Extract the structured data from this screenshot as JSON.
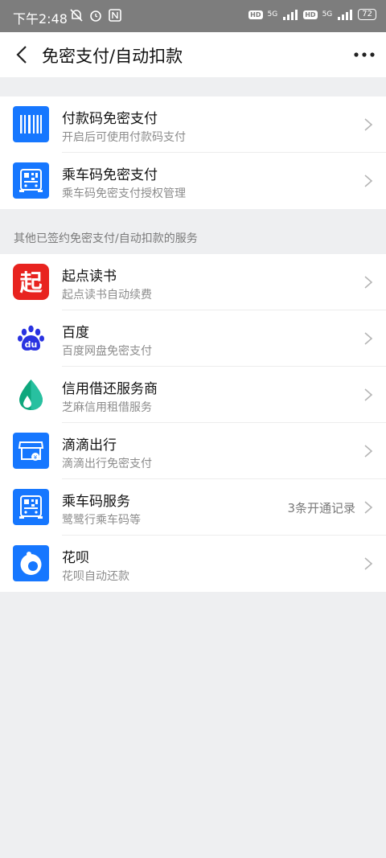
{
  "status": {
    "time": "下午2:48",
    "network1": "5G",
    "network2": "5G",
    "hd": "HD",
    "battery": "72"
  },
  "nav": {
    "title": "免密支付/自动扣款"
  },
  "group1": {
    "items": [
      {
        "title": "付款码免密支付",
        "subtitle": "开启后可使用付款码支付",
        "icon": "barcode-icon"
      },
      {
        "title": "乘车码免密支付",
        "subtitle": "乘车码免密支付授权管理",
        "icon": "bus-qr-icon"
      }
    ]
  },
  "section2": {
    "header": "其他已签约免密支付/自动扣款的服务"
  },
  "group2": {
    "items": [
      {
        "title": "起点读书",
        "subtitle": "起点读书自动续费",
        "icon": "qidian-logo-icon",
        "logo_text": "起"
      },
      {
        "title": "百度",
        "subtitle": "百度网盘免密支付",
        "icon": "baidu-logo-icon",
        "logo_text": "du"
      },
      {
        "title": "信用借还服务商",
        "subtitle": "芝麻信用租借服务",
        "icon": "credit-drop-icon"
      },
      {
        "title": "滴滴出行",
        "subtitle": "滴滴出行免密支付",
        "icon": "didi-shop-icon"
      },
      {
        "title": "乘车码服务",
        "subtitle": "鹭鹭行乘车码等",
        "trailing": "3条开通记录",
        "icon": "bus-qr-icon"
      },
      {
        "title": "花呗",
        "subtitle": "花呗自动还款",
        "icon": "huabei-logo-icon"
      }
    ]
  },
  "colors": {
    "alipay_blue": "#1677ff",
    "qidian_red": "#e8231f",
    "status_bar": "#7d7d7d"
  }
}
